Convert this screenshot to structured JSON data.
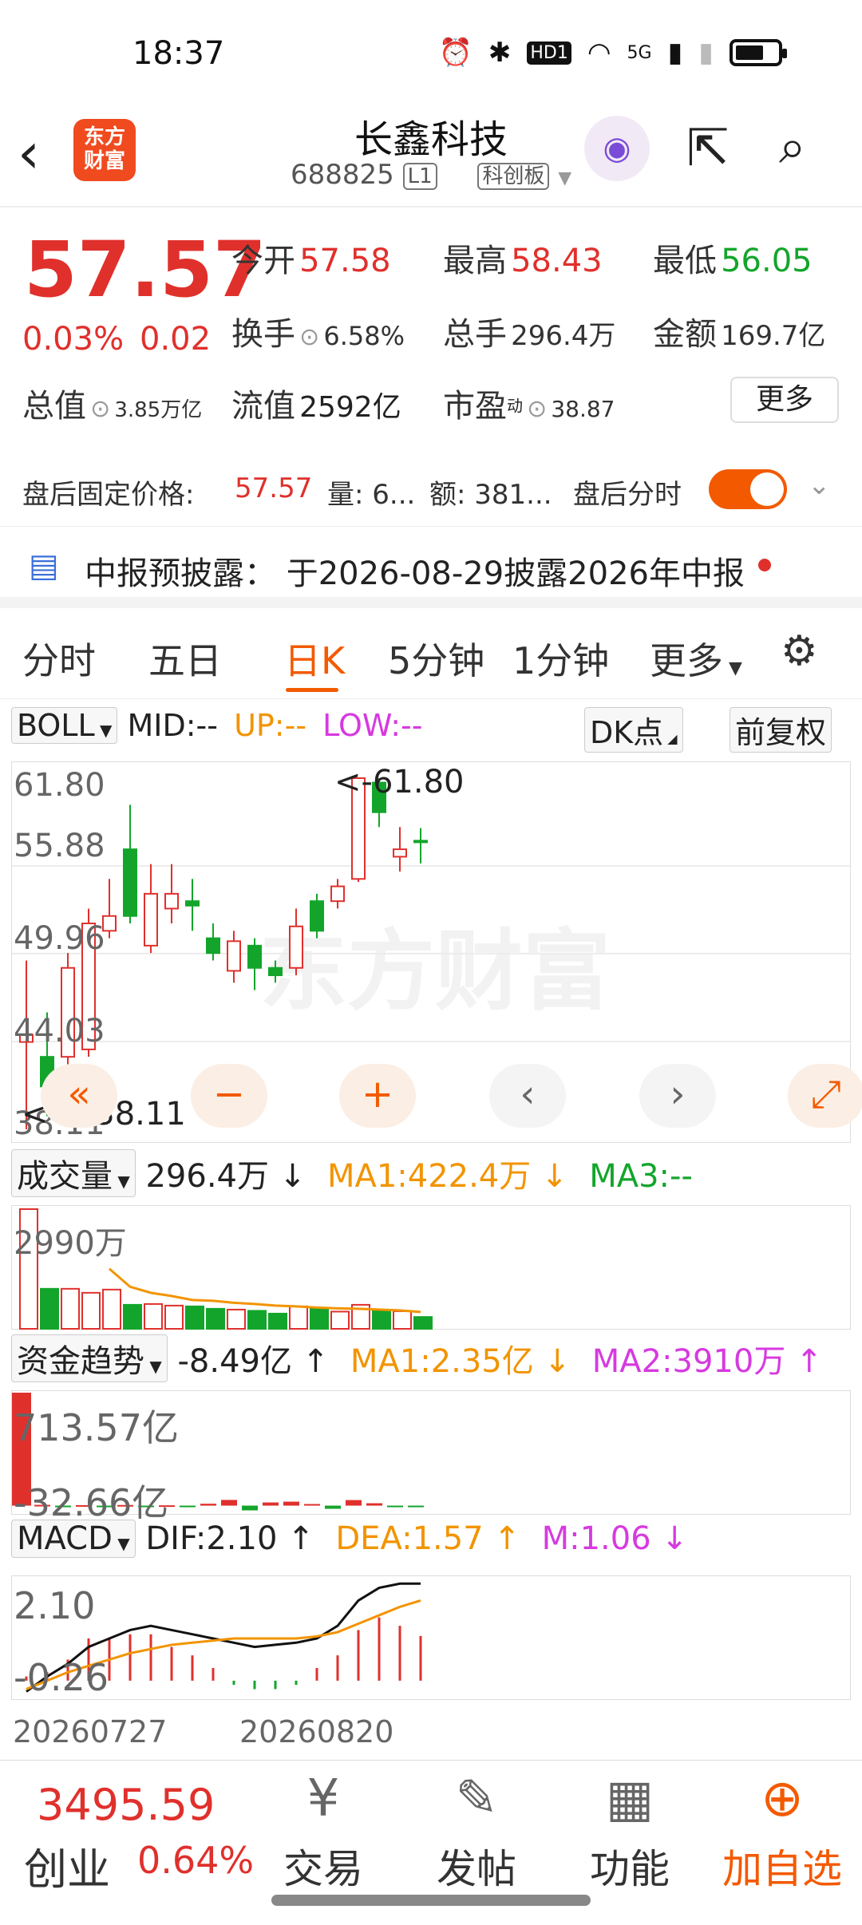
{
  "status_bar": {
    "time": "18:37",
    "network": "5G",
    "hd": "HD1"
  },
  "header": {
    "title": "长鑫科技",
    "code": "688825",
    "level": "L1",
    "board": "科创板",
    "logo_line1": "东方",
    "logo_line2": "财富"
  },
  "quote": {
    "price": "57.57",
    "change_pct": "0.03%",
    "change": "0.02",
    "open_label": "今开",
    "open": "57.58",
    "high_label": "最高",
    "high": "58.43",
    "low_label": "最低",
    "low": "56.05",
    "turnover_label": "换手",
    "turnover": "6.58%",
    "volume_label": "总手",
    "volume": "296.4万",
    "amount_label": "金额",
    "amount": "169.7亿",
    "mktcap_label": "总值",
    "mktcap": "3.85万亿",
    "float_label": "流值",
    "float": "2592亿",
    "pe_label": "市盈",
    "pe_sup": "动",
    "pe": "38.87",
    "more": "更多"
  },
  "after_hours": {
    "label": "盘后固定价格:",
    "price": "57.57",
    "vol": "量: 6...",
    "amt": "额: 381...",
    "toggle_label": "盘后分时"
  },
  "notice": {
    "text": "中报预披露：  于2026-08-29披露2026年中报"
  },
  "tabs": [
    "分时",
    "五日",
    "日K",
    "5分钟",
    "1分钟",
    "更多",
    "⚙"
  ],
  "colors": {
    "up": "#e0302c",
    "down": "#13a52b",
    "accent": "#f35a00",
    "ma1": "#f29400",
    "ma3": "#13a52b",
    "magenta": "#d63adf"
  },
  "kline": {
    "indicator": "BOLL",
    "mid": "MID:--",
    "up": "UP:--",
    "low": "LOW:--",
    "dk": "DK点",
    "fq": "前复权",
    "axis": [
      "61.80",
      "55.88",
      "49.96",
      "44.03",
      "38.11"
    ],
    "max_label": "<-61.80",
    "min_label": "<----38.11",
    "watermark": "东方财富",
    "ctrl": [
      "«",
      "−",
      "+",
      "‹",
      "›",
      "⤢"
    ],
    "candles": [
      {
        "o": 44,
        "c": 44.5,
        "h": 49.5,
        "l": 38.11
      },
      {
        "o": 43,
        "c": 41,
        "h": 46,
        "l": 39
      },
      {
        "o": 43,
        "c": 49,
        "h": 50,
        "l": 42.5
      },
      {
        "o": 43.5,
        "c": 52,
        "h": 53,
        "l": 43
      },
      {
        "o": 51.5,
        "c": 52.5,
        "h": 55,
        "l": 51
      },
      {
        "o": 57,
        "c": 52.5,
        "h": 60,
        "l": 52
      },
      {
        "o": 50.5,
        "c": 54,
        "h": 56,
        "l": 50
      },
      {
        "o": 53,
        "c": 54,
        "h": 56,
        "l": 52
      },
      {
        "o": 53.5,
        "c": 53.2,
        "h": 55,
        "l": 51.5
      },
      {
        "o": 51,
        "c": 50,
        "h": 52,
        "l": 49.5
      },
      {
        "o": 48.8,
        "c": 50.8,
        "h": 51.5,
        "l": 48
      },
      {
        "o": 50.5,
        "c": 49,
        "h": 51,
        "l": 47.5
      },
      {
        "o": 49,
        "c": 48.5,
        "h": 49.5,
        "l": 48
      },
      {
        "o": 49,
        "c": 51.8,
        "h": 53,
        "l": 48.5
      },
      {
        "o": 53.5,
        "c": 51.5,
        "h": 54,
        "l": 51
      },
      {
        "o": 53.5,
        "c": 54.5,
        "h": 55,
        "l": 53
      },
      {
        "o": 55,
        "c": 61.8,
        "h": 61.8,
        "l": 54.8
      },
      {
        "o": 61.5,
        "c": 59.5,
        "h": 61.8,
        "l": 58.5
      },
      {
        "o": 56.5,
        "c": 57,
        "h": 58.5,
        "l": 55.5
      },
      {
        "o": 57.58,
        "c": 57.57,
        "h": 58.43,
        "l": 56.05
      }
    ]
  },
  "volume": {
    "label": "成交量",
    "value": "296.4万 ↓",
    "ma1": "MA1:422.4万 ↓",
    "ma3": "MA3:--",
    "axis_top": "2990万",
    "bars": [
      2990,
      1000,
      1000,
      900,
      980,
      600,
      620,
      580,
      560,
      500,
      480,
      450,
      380,
      560,
      520,
      430,
      600,
      450,
      440,
      296
    ],
    "ma1_line": [
      null,
      null,
      null,
      null,
      1500,
      1050,
      900,
      820,
      720,
      700,
      650,
      620,
      580,
      560,
      530,
      510,
      500,
      480,
      460,
      422
    ]
  },
  "fund": {
    "label": "资金趋势",
    "value": "-8.49亿 ↑",
    "ma1": "MA1:2.35亿 ↓",
    "ma2": "MA2:3910万 ↑",
    "axis_top": "713.57亿",
    "axis_bottom": "-32.66亿",
    "bars": [
      713.57,
      5,
      -10,
      3,
      -6,
      4,
      -4,
      2,
      -2,
      12,
      36,
      -30,
      20,
      25,
      10,
      -20,
      35,
      15,
      -8.49,
      -8.49
    ]
  },
  "macd": {
    "label": "MACD",
    "dif": "DIF:2.10 ↑",
    "dea": "DEA:1.57 ↑",
    "m": "M:1.06 ↓",
    "axis_top": "2.10",
    "axis_bottom": "-0.26",
    "dif_line": [
      -0.26,
      0.1,
      0.4,
      0.8,
      1.0,
      1.2,
      1.3,
      1.2,
      1.1,
      1.0,
      0.9,
      0.8,
      0.85,
      0.9,
      1.0,
      1.3,
      1.9,
      2.2,
      2.3,
      2.3
    ],
    "dea_line": [
      -0.2,
      0.0,
      0.2,
      0.35,
      0.5,
      0.65,
      0.75,
      0.85,
      0.9,
      0.95,
      1.0,
      1.0,
      1.0,
      1.0,
      1.05,
      1.15,
      1.35,
      1.55,
      1.75,
      1.9
    ],
    "m_bars": [
      0.1,
      0.2,
      0.5,
      1.0,
      1.0,
      1.1,
      1.1,
      0.8,
      0.6,
      0.3,
      -0.1,
      -0.2,
      -0.2,
      -0.1,
      0.3,
      0.6,
      1.2,
      1.5,
      1.3,
      1.06
    ],
    "date_left": "20260727",
    "date_right": "20260820"
  },
  "bottom": {
    "index_value": "3495.59",
    "index_name": "创业",
    "index_pct": "0.64%",
    "nav": [
      "交易",
      "发帖",
      "功能",
      "加自选"
    ]
  }
}
